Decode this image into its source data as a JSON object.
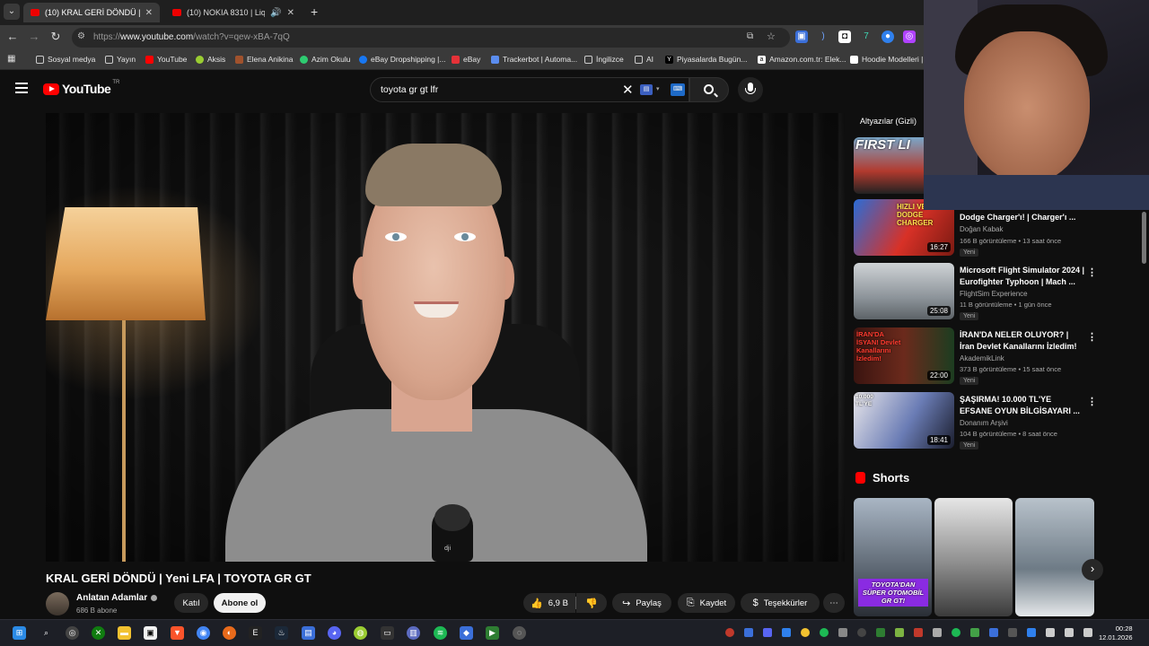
{
  "browser": {
    "tabs": [
      {
        "title": "(10) KRAL GERİ DÖNDÜ | Yeni LFA | TOYOTA GR GT",
        "active": true
      },
      {
        "title": "(10) NOKIA 8310 | Liquid Dabi",
        "active": false
      }
    ],
    "url_prefix": "https://",
    "url_host": "www.youtube.com",
    "url_path": "/watch?v=qew-xBA-7qQ",
    "bookmarks": [
      "Sosyal medya",
      "Yayın",
      "YouTube",
      "Aksis",
      "Elena Anikina",
      "Azim Okulu",
      "eBay Dropshipping |...",
      "eBay",
      "Trackerbot | Automa...",
      "İngilizce",
      "AI",
      "Piyasalarda Bugün...",
      "Amazon.com.tr: Elek...",
      "Hoodie Modelleri |"
    ]
  },
  "youtube": {
    "logo_text": "YouTube",
    "country": "TR",
    "search_query": "toyota gr gt lfr"
  },
  "video": {
    "title": "KRAL GERİ DÖNDÜ | Yeni LFA | TOYOTA GR GT",
    "channel": "Anlatan Adamlar",
    "subscribers": "686 B abone",
    "join_label": "Katıl",
    "subscribe_label": "Abone ol",
    "likes": "6,9 B",
    "share_label": "Paylaş",
    "save_label": "Kaydet",
    "thanks_label": "Teşekkürler",
    "mic_brand": "dji"
  },
  "sidebar": {
    "subtitle_tag": "Altyazılar (Gizli)",
    "recs": [
      {
        "title": "",
        "thumb_text": "FIRST LI",
        "duration": "",
        "channel": "",
        "meta": "",
        "new": ""
      },
      {
        "title": "Dodge Charger'ı! | Charger'ı ...",
        "thumb_text": "HIZLI VE DODGE CHARGER",
        "duration": "16:27",
        "channel": "Doğan Kabak",
        "meta": "166 B görüntüleme • 13 saat önce",
        "new": "Yeni"
      },
      {
        "title": "Microsoft Flight Simulator 2024 | Eurofighter Typhoon | Mach ...",
        "thumb_text": "",
        "duration": "25:08",
        "channel": "FlightSim Experience",
        "meta": "11 B görüntüleme • 1 gün önce",
        "new": "Yeni"
      },
      {
        "title": "İRAN'DA NELER OLUYOR? | İran Devlet Kanallarını İzledim!",
        "thumb_text": "İRAN'DA İSYAN! Devlet Kanallarını İzledim!",
        "duration": "22:00",
        "channel": "AkademikLink",
        "meta": "373 B görüntüleme • 15 saat önce",
        "new": "Yeni"
      },
      {
        "title": "ŞAŞIRMA! 10.000 TL'YE EFSANE OYUN BİLGİSAYARI ...",
        "thumb_text": "10.000 TL'YE",
        "duration": "18:41",
        "channel": "Donanım Arşivi",
        "meta": "104 B görüntüleme • 8 saat önce",
        "new": "Yeni"
      }
    ],
    "shorts_title": "Shorts",
    "shorts": [
      {
        "caption": "TOYOTA'DAN SÜPER OTOMOBİL GR GT!"
      },
      {
        "caption": ""
      },
      {
        "caption": ""
      }
    ]
  },
  "taskbar": {
    "time": "00:28",
    "date": "12.01.2026"
  },
  "colors": {
    "youtube_red": "#ff0000",
    "bg": "#0f0f0f",
    "chip": "#272727"
  }
}
